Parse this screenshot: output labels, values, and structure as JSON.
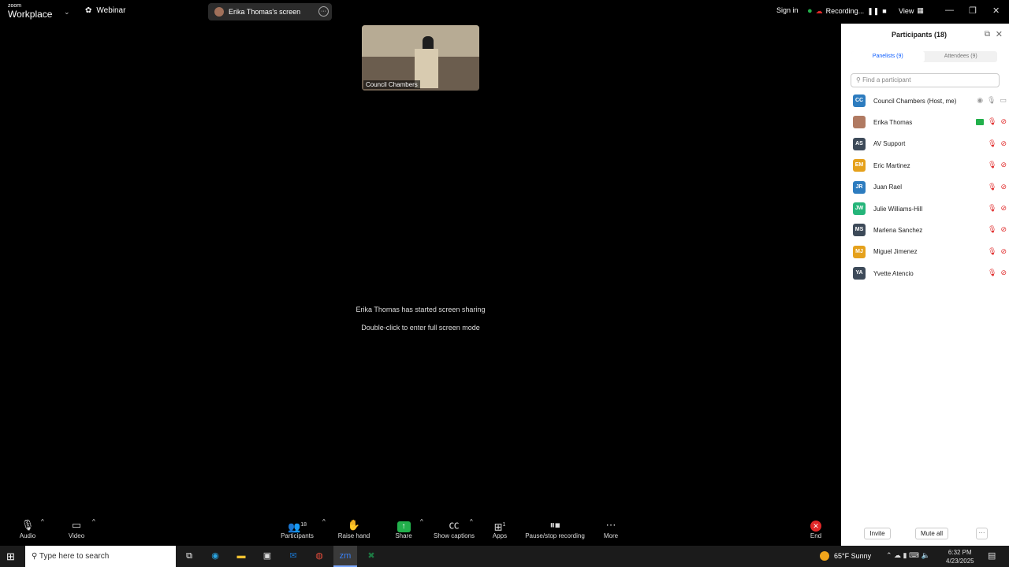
{
  "titlebar": {
    "brand_top": "zoom",
    "brand_bottom": "Workplace",
    "meeting_type": "Webinar",
    "shared_screen_label": "Erika Thomas's screen",
    "sign_in": "Sign in",
    "recording": "Recording...",
    "view": "View"
  },
  "video": {
    "thumbnail_label": "Council Chambers"
  },
  "main": {
    "message": "Erika Thomas has started screen sharing",
    "hint": "Double-click to enter full screen mode"
  },
  "toolbar": {
    "audio": "Audio",
    "video": "Video",
    "participants": "Participants",
    "participants_count": "18",
    "raise_hand": "Raise hand",
    "share": "Share",
    "captions": "Show captions",
    "apps": "Apps",
    "apps_count": "1",
    "record": "Pause/stop recording",
    "more": "More",
    "end": "End"
  },
  "panel": {
    "title": "Participants (18)",
    "tab_panelists": "Panelists (9)",
    "tab_attendees": "Attendees (9)",
    "search_placeholder": "Find a participant",
    "participants": [
      {
        "initials": "CC",
        "name": "Council Chambers (Host, me)",
        "color": "#2d7cbf"
      },
      {
        "initials": "",
        "name": "Erika Thomas",
        "color": "#b07a62"
      },
      {
        "initials": "AS",
        "name": "AV Support",
        "color": "#3d4a59"
      },
      {
        "initials": "EM",
        "name": "Eric Martinez",
        "color": "#e5a11c"
      },
      {
        "initials": "JR",
        "name": "Juan Rael",
        "color": "#2d7cbf"
      },
      {
        "initials": "JW",
        "name": "Julie Williams-Hill",
        "color": "#25b57a"
      },
      {
        "initials": "MS",
        "name": "Marlena Sanchez",
        "color": "#3d4a59"
      },
      {
        "initials": "MJ",
        "name": "Miguel Jimenez",
        "color": "#e5a11c"
      },
      {
        "initials": "YA",
        "name": "Yvette Atencio",
        "color": "#3d4a59"
      }
    ],
    "invite": "Invite",
    "mute_all": "Mute all"
  },
  "taskbar": {
    "search_placeholder": "Type here to search",
    "weather": "65°F  Sunny",
    "time": "6:32 PM",
    "date": "4/23/2025"
  }
}
